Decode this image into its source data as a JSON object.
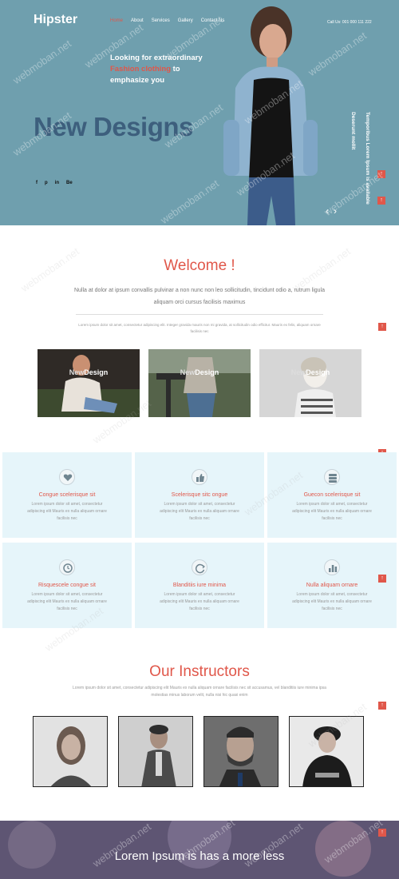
{
  "header": {
    "brand": "Hipster",
    "nav": [
      "Home",
      "About",
      "Services",
      "Gallery",
      "Contact Us"
    ],
    "call": "Call Us: 001 000 111 222"
  },
  "hero": {
    "tag_line1": "Looking for extraordinary",
    "tag_highlight": "Fashion clothing",
    "tag_to": " to",
    "tag_line3": "emphasize you",
    "title": "New Designs",
    "vertical_text1": "Temporibus Lorem Ipsum is available",
    "vertical_text2": "Deserunt mollit",
    "socials": [
      "f",
      "p",
      "in",
      "Be"
    ],
    "prev": "‹",
    "next": "›"
  },
  "welcome": {
    "title": "Welcome !",
    "lead": "Nulla at dolor at ipsum convallis pulvinar a non nunc non leo sollicitudin, tincidunt odio a, rutrum ligula aliquam orci cursus facilisis maximus",
    "small": "Lorem ipsum dolor sit amet, consectetur adipiscing elit. Integer gravida mauris non mi gravida, at sollicitudin odio efficitur. Mauris ex felis, aliquam ornare facilisis nec",
    "designs": [
      {
        "new": "New",
        "design": "Design"
      },
      {
        "new": "New",
        "design": "Design"
      },
      {
        "new": "New",
        "design": "Design"
      }
    ]
  },
  "features": [
    {
      "title": "Congue scelerisque sit",
      "text": "Lorem ipsum dolor sit amet, consectetur adipiscing elit Mauris ex nulla aliquam ornare facilisis nec",
      "icon": "heart-icon"
    },
    {
      "title": "Scelerisque sitc ongue",
      "text": "Lorem ipsum dolor sit amet, consectetur adipiscing elit Mauris ex nulla aliquam ornare facilisis nec",
      "icon": "thumbs-up-icon"
    },
    {
      "title": "Guecon scelerisque sit",
      "text": "Lorem ipsum dolor sit amet, consectetur adipiscing elit Mauris ex nulla aliquam ornare facilisis nec",
      "icon": "database-icon"
    },
    {
      "title": "Risquescele congue sit",
      "text": "Lorem ipsum dolor sit amet, consectetur adipiscing elit Mauris ex nulla aliquam ornare facilisis nec",
      "icon": "clock-icon"
    },
    {
      "title": "Blanditiis iure minima",
      "text": "Lorem ipsum dolor sit amet, consectetur adipiscing elit Mauris ex nulla aliquam ornare facilisis nec",
      "icon": "refresh-icon"
    },
    {
      "title": "Nulla aliquam ornare",
      "text": "Lorem ipsum dolor sit amet, consectetur adipiscing elit Mauris ex nulla aliquam ornare facilisis nec",
      "icon": "bar-chart-icon"
    }
  ],
  "instructors": {
    "title": "Our Instructors",
    "lead": "Lorem ipsum dolor sit amet, consectetur adipiscing elit Mauris ex nulla aliquam ornare facilisis nec sit accusamus, vel blanditiis iure minima ipsa molestias minus laborum velit, nulla nisi hic quasi enim"
  },
  "banner": {
    "text": "Lorem Ipsum is has a more less"
  },
  "up_arrow": "↑",
  "watermark": "webmoban.net",
  "colors": {
    "accent": "#e0574a",
    "hero_bg": "#6f9fae",
    "title_blue": "#3d5f7d",
    "feature_bg": "#e6f5fa"
  }
}
